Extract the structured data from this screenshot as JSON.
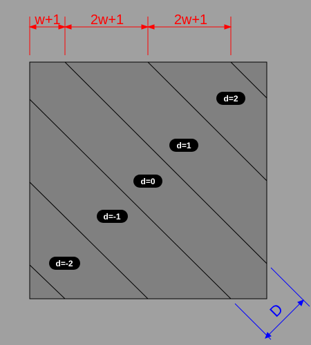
{
  "colors": {
    "background": "#a0a0a0",
    "square_fill": "#808080",
    "line": "#000000",
    "top_dimension": "#ff0000",
    "right_dimension": "#0000ff",
    "label_fill": "#000000",
    "label_text": "#ffffff"
  },
  "top_dimensions": [
    "w+1",
    "2w+1",
    "2w+1"
  ],
  "side_dimension": "D",
  "band_labels": [
    "d=2",
    "d=1",
    "d=0",
    "d=-1",
    "d=-2"
  ]
}
